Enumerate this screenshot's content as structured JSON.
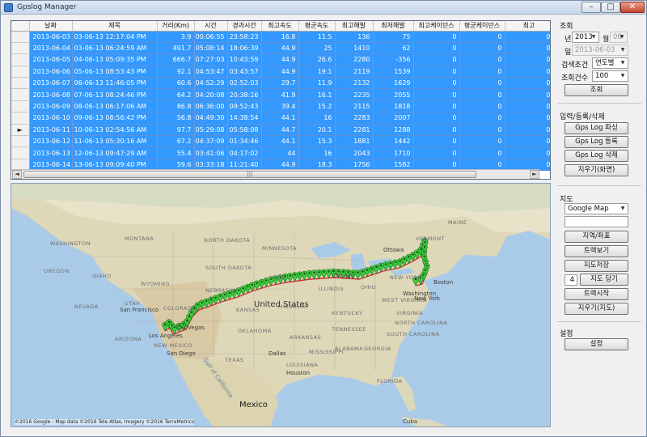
{
  "window": {
    "title": "Gpslog Manager",
    "min": "–",
    "max": "□",
    "close": "✕"
  },
  "grid": {
    "headers": [
      "날짜",
      "제목",
      "거리(Km)",
      "시간",
      "경과시간",
      "최고속도",
      "평균속도",
      "최고해발",
      "최저해발",
      "최고케이던스",
      "평균케이던스",
      "최고"
    ],
    "rows": [
      [
        "2013-06-03",
        "03-06-13 12:17:04 PM",
        "3.9",
        "00:06:55",
        "23:58:23",
        "16.8",
        "11.5",
        "136",
        "75",
        "0",
        "0",
        "0"
      ],
      [
        "2013-06-04",
        "03-06-13 06:24:59 AM",
        "491.7",
        "05:08:14",
        "18:06:39",
        "44.9",
        "25",
        "1410",
        "62",
        "0",
        "0",
        "0"
      ],
      [
        "2013-06-05",
        "04-06-13 05:09:35 PM",
        "666.7",
        "07:27:03",
        "10:43:59",
        "44.9",
        "26.6",
        "2280",
        "-356",
        "0",
        "0",
        "0"
      ],
      [
        "2013-06-06",
        "05-06-13 08:53:43 PM",
        "92.1",
        "04:53:47",
        "03:43:57",
        "44.9",
        "19.1",
        "2119",
        "1539",
        "0",
        "0",
        "0"
      ],
      [
        "2013-06-07",
        "06-06-13 11:46:05 PM",
        "60.6",
        "04:52:29",
        "02:52:03",
        "29.7",
        "11.9",
        "2132",
        "1629",
        "0",
        "0",
        "0"
      ],
      [
        "2013-06-08",
        "07-06-13 08:24:46 PM",
        "64.2",
        "04:20:08",
        "20:38:16",
        "41.9",
        "16.1",
        "2235",
        "2055",
        "0",
        "0",
        "0"
      ],
      [
        "2013-06-09",
        "08-06-13 06:17:06 AM",
        "86.8",
        "06:36:00",
        "09:52:43",
        "39.4",
        "15.2",
        "2115",
        "1818",
        "0",
        "0",
        "0"
      ],
      [
        "2013-06-10",
        "09-06-13 08:56:42 PM",
        "56.8",
        "04:49:30",
        "14:38:54",
        "44.1",
        "16",
        "2283",
        "2007",
        "0",
        "0",
        "0"
      ],
      [
        "2013-06-11",
        "10-06-13 02:54:56 AM",
        "97.7",
        "05:29:08",
        "05:58:08",
        "44.7",
        "20.1",
        "2281",
        "1288",
        "0",
        "0",
        "0"
      ],
      [
        "2013-06-12",
        "11-06-13 05:30:16 AM",
        "67.2",
        "04:37:09",
        "01:34:46",
        "44.1",
        "15.3",
        "1881",
        "1442",
        "0",
        "0",
        "0"
      ],
      [
        "2013-06-13",
        "12-06-13 09:47:29 AM",
        "55.4",
        "03:41:06",
        "04:17:02",
        "44",
        "16",
        "2043",
        "1710",
        "0",
        "0",
        "0"
      ],
      [
        "2013-06-14",
        "13-06-13 09:09:40 PM",
        "59.6",
        "03:33:18",
        "11:21:40",
        "44.9",
        "18.3",
        "1756",
        "1582",
        "0",
        "0",
        "0"
      ]
    ],
    "current_row_marker": "►",
    "hscroll_grip": "|||",
    "hscroll_left": "◄",
    "hscroll_right": "►",
    "vscroll_up": "▲",
    "vscroll_down": "▼"
  },
  "map": {
    "labels": {
      "ottawa": "Ottawa",
      "maine": "MAINE",
      "vermont": "VERMONT",
      "washington": "WASHINGTON",
      "montana": "MONTANA",
      "north_dakota": "NORTH DAKOTA",
      "minnesota": "MINNESOTA",
      "oregon": "OREGON",
      "idaho": "IDAHO",
      "south_dakota": "SOUTH DAKOTA",
      "wyoming": "WYOMING",
      "nebraska": "NEBRASKA",
      "iowa": "IOWA",
      "nevada": "NEVADA",
      "utah": "UTAH",
      "colorado": "COLORADO",
      "kansas": "KANSAS",
      "missouri": "MISSOURI",
      "illinois": "ILLINOIS",
      "ohio": "OHIO",
      "new_york": "NEW YORK",
      "kentucky": "KENTUCKY",
      "west_virginia": "WEST VIRGINIA",
      "virginia": "VIRGINIA",
      "tennessee": "TENNESSEE",
      "oklahoma": "OKLAHOMA",
      "arkansas": "ARKANSAS",
      "arizona": "ARIZONA",
      "new_mexico": "NEW MEXICO",
      "texas": "TEXAS",
      "louisiana": "LOUISIANA",
      "mississippi": "MISSISSIPPI",
      "alabama": "ALABAMA",
      "georgia": "GEORGIA",
      "south_carolina": "SOUTH CAROLINA",
      "north_carolina": "NORTH CAROLINA",
      "florida": "FLORIDA",
      "san_francisco": "San Francisco",
      "los_angeles": "Los Angeles",
      "san_diego": "San Diego",
      "las_vegas": "Las Vegas",
      "chicago": "Chicago",
      "washington_dc": "Washington",
      "boston": "Boston",
      "new_york_city": "New York",
      "houston": "Houston",
      "dallas": "Dallas",
      "mexico": "Mexico",
      "cuba": "Cuba",
      "gulf_california": "Gulf of California",
      "united_states": "United States"
    },
    "copyright": "©2016 Google - Map data ©2016 Tele Atlas, Imagery ©2016 TerraMetrics"
  },
  "panel": {
    "query_section": "조회",
    "year_label": "년",
    "year_value": "2013",
    "month_label": "월",
    "month_value": "06",
    "day_label": "일",
    "day_value": "2013-06-03",
    "search_cond_label": "검색조건",
    "search_cond_value": "연도별",
    "count_label": "조회건수",
    "count_value": "100",
    "query_button": "조회",
    "io_section": "입력/등록/삭제",
    "parse_button": "Gps Log 파싱",
    "register_button": "Gps Log 등록",
    "delete_button": "Gps Log 삭제",
    "clear_screen_button": "지우기(화면)",
    "map_section": "지도",
    "map_type_value": "Google Map",
    "map_text_value": "",
    "region_coord_button": "지역/좌표",
    "track_view_button": "트랙보기",
    "map_save_button": "지도저장",
    "zoom_value": "4",
    "zoom_button": "지도 당기",
    "track_start_button": "트랙시작",
    "clear_map_button": "지우기(지도)",
    "settings_section": "설정",
    "settings_button": "설정"
  }
}
